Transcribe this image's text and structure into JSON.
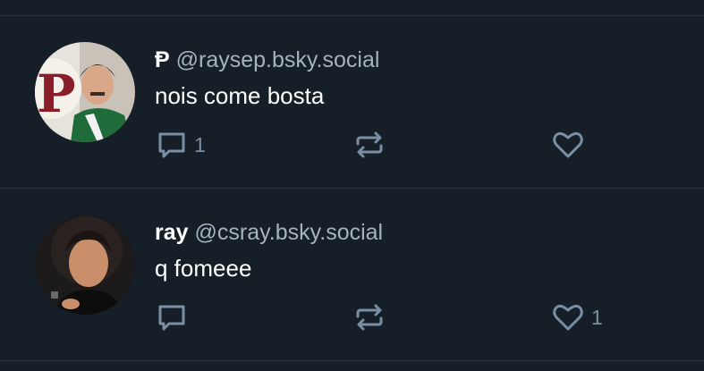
{
  "feed": {
    "posts": [
      {
        "display_name": "Ᵽ",
        "handle": "@raysep.bsky.social",
        "text": "nois come bosta",
        "reply_count": "1",
        "repost_count": "",
        "like_count": ""
      },
      {
        "display_name": "ray",
        "handle": "@csray.bsky.social",
        "text": "q fomeee",
        "reply_count": "",
        "repost_count": "",
        "like_count": "1"
      }
    ]
  },
  "icons": {
    "reply": "speech-bubble-icon",
    "repost": "repost-arrows-icon",
    "like": "heart-icon"
  },
  "colors": {
    "background": "#161e27",
    "divider": "#2a3540",
    "handle": "#a5b2c0",
    "action_icon": "#7a8ea4"
  }
}
